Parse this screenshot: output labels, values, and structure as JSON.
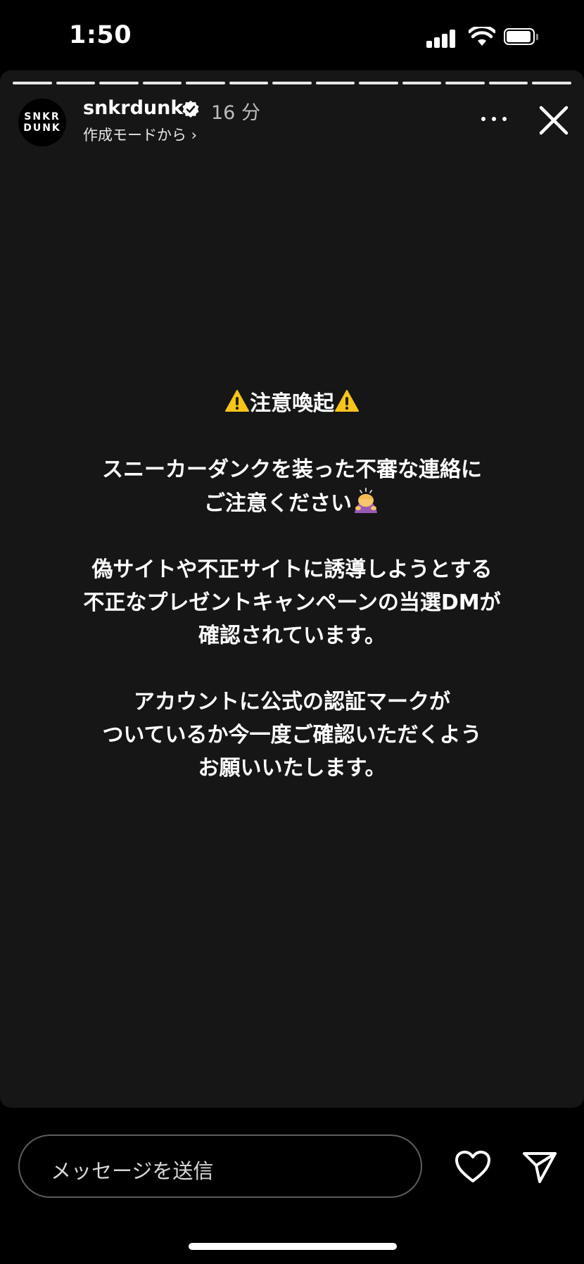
{
  "status_bar": {
    "time": "1:50",
    "icons": [
      "cellular-signal-icon",
      "wifi-icon",
      "battery-icon"
    ]
  },
  "story": {
    "segment_count": 13,
    "account": {
      "avatar_text": "SNKR\nDUNK",
      "username": "snkrdunk",
      "verified": true,
      "time_ago": "16 分",
      "subline": "作成モードから ›"
    },
    "content": {
      "heading": "注意喚起",
      "paragraphs": [
        [
          "スニーカーダンクを装った不審な連絡に",
          "ご注意ください"
        ],
        [
          "偽サイトや不正サイトに誘導しようとする",
          "不正なプレゼントキャンペーンの当選DMが",
          "確認されています。"
        ],
        [
          "アカウントに公式の認証マークが",
          "ついているか今一度ご確認いただくよう",
          "お願いいたします。"
        ]
      ]
    }
  },
  "bottom_bar": {
    "message_placeholder": "メッセージを送信",
    "icons": [
      "heart-icon",
      "send-icon"
    ]
  },
  "colors": {
    "background": "#000000",
    "story_background": "#161616",
    "warning_yellow": "#F5C518"
  }
}
